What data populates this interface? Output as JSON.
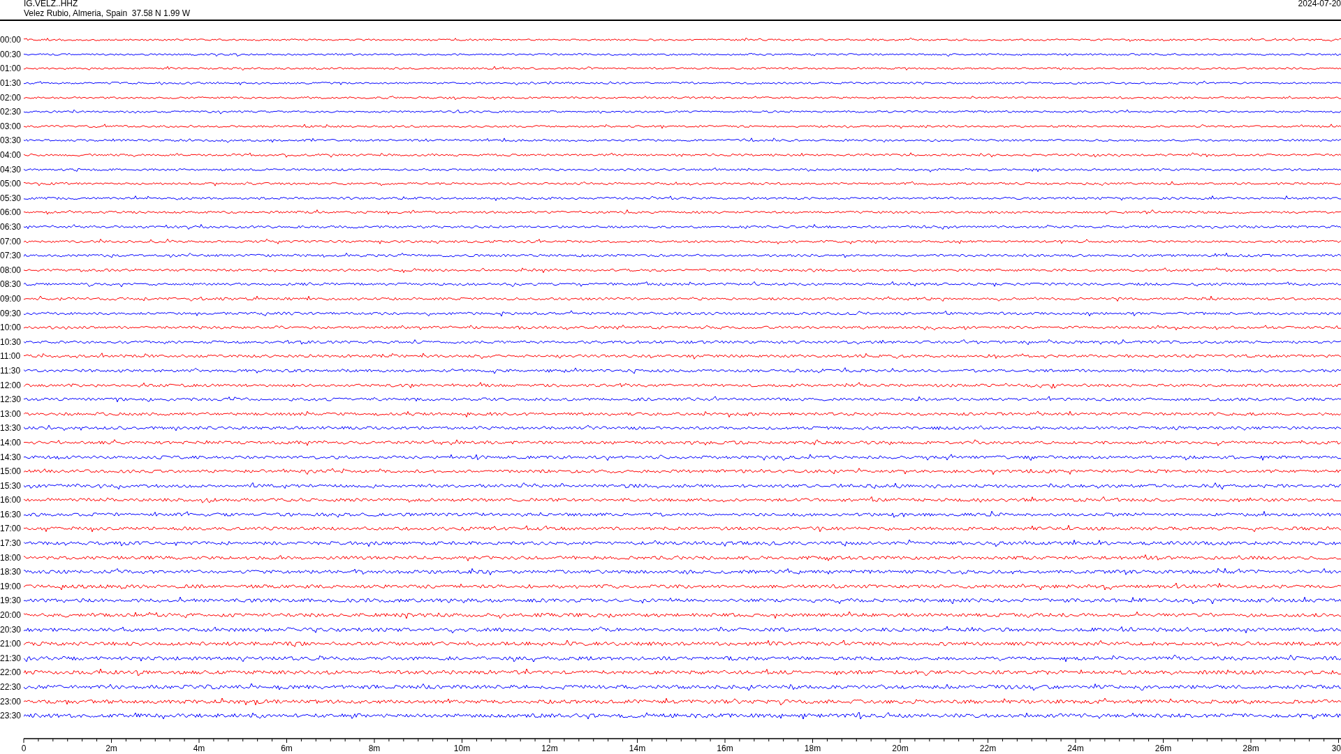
{
  "header": {
    "station": "IG.VELZ..HHZ",
    "location": "Velez Rubio, Almeria, Spain  37.58 N 1.99 W",
    "date": "2024-07-20"
  },
  "rows": [
    {
      "label": "00:00",
      "color": "#ff0000"
    },
    {
      "label": "00:30",
      "color": "#0000ff"
    },
    {
      "label": "01:00",
      "color": "#ff0000"
    },
    {
      "label": "01:30",
      "color": "#0000ff"
    },
    {
      "label": "02:00",
      "color": "#ff0000"
    },
    {
      "label": "02:30",
      "color": "#0000ff"
    },
    {
      "label": "03:00",
      "color": "#ff0000"
    },
    {
      "label": "03:30",
      "color": "#0000ff"
    },
    {
      "label": "04:00",
      "color": "#ff0000"
    },
    {
      "label": "04:30",
      "color": "#0000ff"
    },
    {
      "label": "05:00",
      "color": "#ff0000"
    },
    {
      "label": "05:30",
      "color": "#0000ff"
    },
    {
      "label": "06:00",
      "color": "#ff0000"
    },
    {
      "label": "06:30",
      "color": "#0000ff"
    },
    {
      "label": "07:00",
      "color": "#ff0000"
    },
    {
      "label": "07:30",
      "color": "#0000ff"
    },
    {
      "label": "08:00",
      "color": "#ff0000"
    },
    {
      "label": "08:30",
      "color": "#0000ff"
    },
    {
      "label": "09:00",
      "color": "#ff0000"
    },
    {
      "label": "09:30",
      "color": "#0000ff"
    },
    {
      "label": "10:00",
      "color": "#ff0000"
    },
    {
      "label": "10:30",
      "color": "#0000ff"
    },
    {
      "label": "11:00",
      "color": "#ff0000"
    },
    {
      "label": "11:30",
      "color": "#0000ff"
    },
    {
      "label": "12:00",
      "color": "#ff0000"
    },
    {
      "label": "12:30",
      "color": "#0000ff"
    },
    {
      "label": "13:00",
      "color": "#ff0000"
    },
    {
      "label": "13:30",
      "color": "#0000ff"
    },
    {
      "label": "14:00",
      "color": "#ff0000"
    },
    {
      "label": "14:30",
      "color": "#0000ff"
    },
    {
      "label": "15:00",
      "color": "#ff0000"
    },
    {
      "label": "15:30",
      "color": "#0000ff"
    },
    {
      "label": "16:00",
      "color": "#ff0000"
    },
    {
      "label": "16:30",
      "color": "#0000ff"
    },
    {
      "label": "17:00",
      "color": "#ff0000"
    },
    {
      "label": "17:30",
      "color": "#0000ff"
    },
    {
      "label": "18:00",
      "color": "#ff0000"
    },
    {
      "label": "18:30",
      "color": "#0000ff"
    },
    {
      "label": "19:00",
      "color": "#ff0000"
    },
    {
      "label": "19:30",
      "color": "#0000ff"
    },
    {
      "label": "20:00",
      "color": "#ff0000"
    },
    {
      "label": "20:30",
      "color": "#0000ff"
    },
    {
      "label": "21:00",
      "color": "#ff0000"
    },
    {
      "label": "21:30",
      "color": "#0000ff"
    },
    {
      "label": "22:00",
      "color": "#ff0000"
    },
    {
      "label": "22:30",
      "color": "#0000ff"
    },
    {
      "label": "23:00",
      "color": "#ff0000"
    },
    {
      "label": "23:30",
      "color": "#0000ff"
    }
  ],
  "x_axis": {
    "ticks": [
      "0",
      "2m",
      "4m",
      "6m",
      "8m",
      "10m",
      "12m",
      "14m",
      "16m",
      "18m",
      "20m",
      "22m",
      "24m",
      "26m",
      "28m",
      "30"
    ]
  }
}
